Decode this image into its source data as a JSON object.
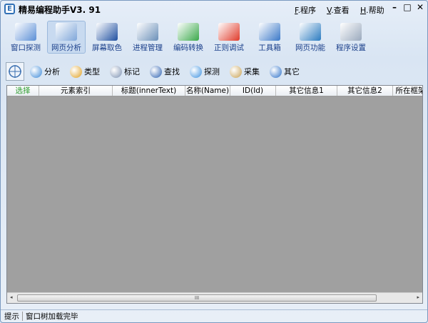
{
  "app": {
    "logo": "E",
    "title": "精易编程助手V3. 91"
  },
  "menu": [
    {
      "key": "F",
      "label": ".程序"
    },
    {
      "key": "V",
      "label": ".查看"
    },
    {
      "key": "H",
      "label": ".帮助"
    }
  ],
  "window_buttons": {
    "minimize": "–",
    "maximize": "□",
    "close": "✕"
  },
  "main_toolbar": [
    {
      "label": "窗口探测",
      "icon": "window-probe-icon",
      "color": "#5b8fd6"
    },
    {
      "label": "网页分析",
      "icon": "web-analyze-icon",
      "color": "#7fa6d9",
      "active": true
    },
    {
      "label": "屏幕取色",
      "icon": "color-picker-icon",
      "color": "#1f4fa0"
    },
    {
      "label": "进程管理",
      "icon": "process-icon",
      "color": "#6a8fb8"
    },
    {
      "label": "编码转换",
      "icon": "encode-icon",
      "color": "#3aa84a"
    },
    {
      "label": "正则调试",
      "icon": "regex-icon",
      "color": "#e03a2a"
    },
    {
      "label": "工具箱",
      "icon": "toolbox-icon",
      "color": "#3a78c8"
    },
    {
      "label": "网页功能",
      "icon": "globe-icon",
      "color": "#2b7bc0"
    },
    {
      "label": "程序设置",
      "icon": "settings-icon",
      "color": "#9aa9bd"
    }
  ],
  "sub_toolbar": [
    {
      "label": "分析",
      "icon": "magnify-icon",
      "color": "#3a88d8"
    },
    {
      "label": "类型",
      "icon": "ie-icon",
      "color": "#e0a020"
    },
    {
      "label": "标记",
      "icon": "mark-icon",
      "color": "#7a8fb0"
    },
    {
      "label": "查找",
      "icon": "binoculars-icon",
      "color": "#2a5fb0"
    },
    {
      "label": "探测",
      "icon": "target-icon",
      "color": "#3a90e0"
    },
    {
      "label": "采集",
      "icon": "collect-icon",
      "color": "#c8a050"
    },
    {
      "label": "其它",
      "icon": "gear-icon",
      "color": "#2a6fc8"
    }
  ],
  "table": {
    "columns": [
      "选择",
      "元素索引",
      "标题(innerText)",
      "名称(Name)",
      "ID(Id)",
      "其它信息1",
      "其它信息2",
      "所在框架"
    ],
    "rows": []
  },
  "scrollbar": {
    "grip": "III",
    "left": "◂",
    "right": "▸"
  },
  "status": {
    "label": "提示",
    "message": "窗口树加载完毕"
  }
}
